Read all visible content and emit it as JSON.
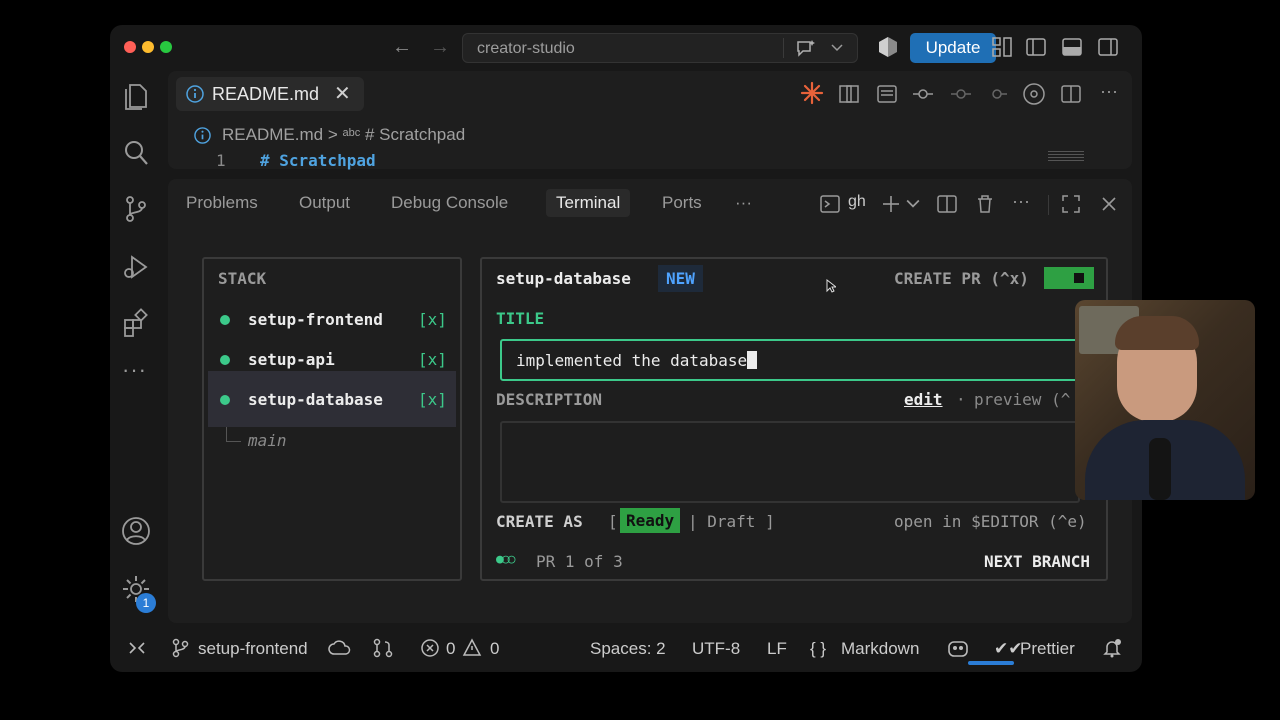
{
  "titlebar": {
    "search_text": "creator-studio",
    "update_label": "Update"
  },
  "editor": {
    "tab_label": "README.md",
    "breadcrumb_file": "README.md",
    "breadcrumb_sep": ">",
    "breadcrumb_abc": "abc",
    "breadcrumb_symbol": "# Scratchpad",
    "line_number": "1",
    "line_code": "# Scratchpad"
  },
  "panel": {
    "tabs": [
      "Problems",
      "Output",
      "Debug Console",
      "Terminal",
      "Ports",
      "···"
    ],
    "active_tab": "Terminal",
    "terminal_name": "gh"
  },
  "tui": {
    "stack_title": "STACK",
    "stack_items": [
      {
        "name": "setup-frontend",
        "mark": "[x]"
      },
      {
        "name": "setup-api",
        "mark": "[x]"
      },
      {
        "name": "setup-database",
        "mark": "[x]"
      }
    ],
    "base_branch": "main",
    "branch_name": "setup-database",
    "branch_badge": "NEW",
    "create_pr": "CREATE PR (^x)",
    "title_label": "TITLE",
    "title_value": "implemented the database",
    "description_label": "DESCRIPTION",
    "edit_label": "edit",
    "dot_sep": "·",
    "preview_label": "preview (^",
    "create_as_label": "CREATE AS",
    "bracket_open": "[",
    "ready_label": "Ready",
    "draft_label": "| Draft ]",
    "open_editor": "open in $EDITOR (^e)",
    "progress_dots": "●○○",
    "pr_counter": "PR 1 of 3",
    "next_branch": "NEXT BRANCH"
  },
  "activity": {
    "settings_badge": "1"
  },
  "statusbar": {
    "branch": "setup-frontend",
    "errors": "0",
    "warnings": "0",
    "spaces": "Spaces: 2",
    "encoding": "UTF-8",
    "eol": "LF",
    "language_brace": "{ }",
    "language": "Markdown",
    "prettier": "Prettier"
  },
  "colors": {
    "accent_green": "#3cc98a",
    "update_blue": "#1f6fb5",
    "new_badge_blue": "#4fa3ff",
    "ready_green": "#2ea043",
    "claude_orange": "#e8623a"
  }
}
